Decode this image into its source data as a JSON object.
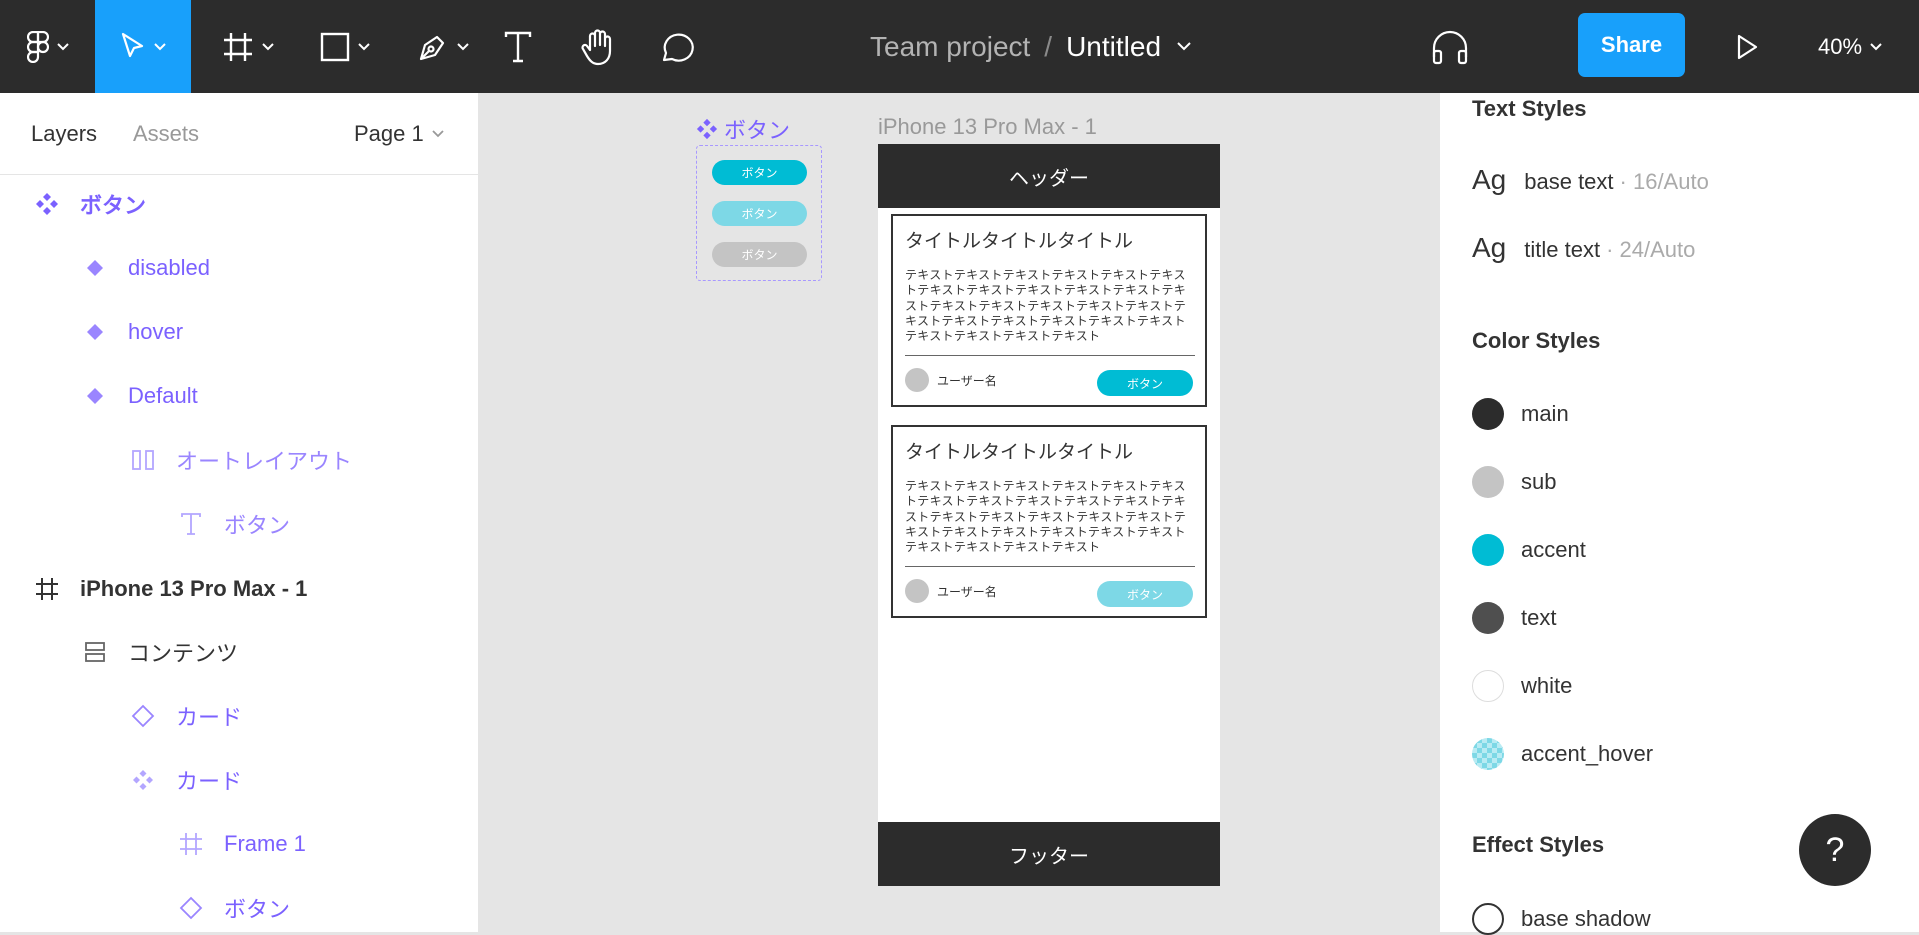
{
  "toolbar": {
    "icons": [
      "figma-menu-icon",
      "move-tool-icon",
      "frame-tool-icon",
      "shape-tool-icon",
      "pen-tool-icon",
      "text-tool-icon",
      "hand-tool-icon",
      "comment-tool-icon",
      "audio-headphones-icon",
      "present-play-icon"
    ],
    "project": "Team project",
    "separator": "/",
    "file_name": "Untitled",
    "share_label": "Share",
    "zoom": "40%",
    "accent": "#18a0fb"
  },
  "left_panel": {
    "tab_layers": "Layers",
    "tab_assets": "Assets",
    "page": "Page 1",
    "layers": [
      {
        "label": "ボタン",
        "icon": "component-set-icon"
      },
      {
        "label": "disabled",
        "icon": "variant-icon"
      },
      {
        "label": "hover",
        "icon": "variant-icon"
      },
      {
        "label": "Default",
        "icon": "variant-icon"
      },
      {
        "label": "オートレイアウト",
        "icon": "auto-layout-icon"
      },
      {
        "label": "ボタン",
        "icon": "text-layer-icon"
      },
      {
        "label": "iPhone 13 Pro Max - 1",
        "icon": "frame-icon"
      },
      {
        "label": "コンテンツ",
        "icon": "auto-layout-vertical-icon"
      },
      {
        "label": "カード",
        "icon": "instance-icon"
      },
      {
        "label": "カード",
        "icon": "component-icon"
      },
      {
        "label": "Frame 1",
        "icon": "frame-icon"
      },
      {
        "label": "ボタン",
        "icon": "instance-icon"
      }
    ]
  },
  "canvas": {
    "component_set_title": "ボタン",
    "variants": [
      {
        "label": "ボタン",
        "color": "#00bcd4"
      },
      {
        "label": "ボタン",
        "color": "#7dd8e6"
      },
      {
        "label": "ボタン",
        "color": "#c4c4c4"
      }
    ],
    "frame_label": "iPhone 13 Pro Max - 1",
    "header": "ヘッダー",
    "footer": "フッター",
    "cards": [
      {
        "title": "タイトルタイトルタイトル",
        "body": "テキストテキストテキストテキストテキストテキストテキストテキストテキストテキストテキストテキストテキストテキストテキストテキストテキストテキストテキストテキストテキストテキストテキストテキストテキストテキストテキスト",
        "user": "ユーザー名",
        "button": "ボタン",
        "button_color": "#00bcd4"
      },
      {
        "title": "タイトルタイトルタイトル",
        "body": "テキストテキストテキストテキストテキストテキストテキストテキストテキストテキストテキストテキストテキストテキストテキストテキストテキストテキストテキストテキストテキストテキストテキストテキストテキストテキストテキスト",
        "user": "ユーザー名",
        "button": "ボタン",
        "button_color": "#7dd8e6"
      }
    ]
  },
  "right_panel": {
    "text_styles_title": "Text Styles",
    "text_styles": [
      {
        "ag": "Ag",
        "name": "base text",
        "meta": "· 16/Auto"
      },
      {
        "ag": "Ag",
        "name": "title text",
        "meta": "· 24/Auto"
      }
    ],
    "color_styles_title": "Color Styles",
    "color_styles": [
      {
        "name": "main",
        "color": "#2c2c2c"
      },
      {
        "name": "sub",
        "color": "#c4c4c4"
      },
      {
        "name": "accent",
        "color": "#00bcd4"
      },
      {
        "name": "text",
        "color": "#4f4f4f"
      },
      {
        "name": "white",
        "color": "#ffffff"
      },
      {
        "name": "accent_hover",
        "color": "#7dd8e6"
      }
    ],
    "effect_styles_title": "Effect Styles",
    "effect_styles": [
      {
        "name": "base shadow"
      }
    ],
    "help": "?"
  }
}
